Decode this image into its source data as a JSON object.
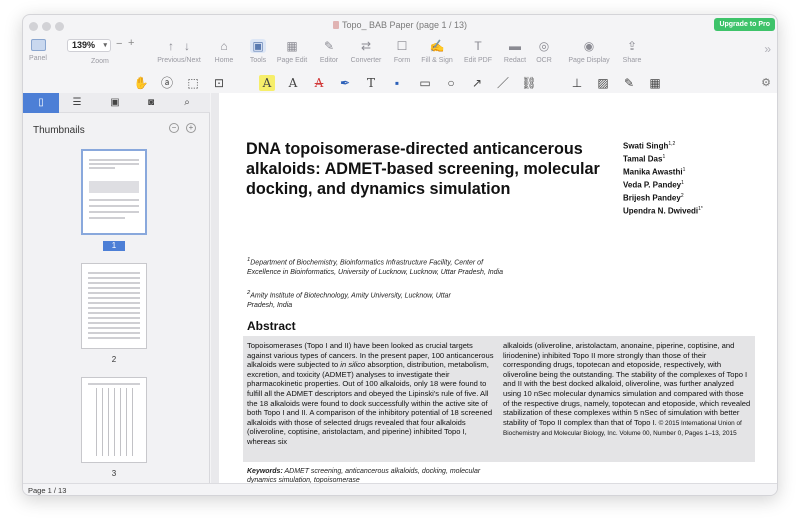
{
  "window": {
    "title": "Topo_ BAB Paper (page 1 / 13)",
    "upgrade_label": "Upgrade to Pro"
  },
  "toolbar": {
    "panel": "Panel",
    "zoom_value": "139%",
    "zoom_label": "Zoom",
    "prev_next": "Previous/Next",
    "home": "Home",
    "tools": "Tools",
    "page_edit": "Page Edit",
    "editor": "Editor",
    "converter": "Converter",
    "form": "Form",
    "fill_sign": "Fill & Sign",
    "edit_pdf": "Edit PDF",
    "redact": "Redact",
    "ocr": "OCR",
    "page_display": "Page Display",
    "share": "Share"
  },
  "sidebar": {
    "thumbnails_title": "Thumbnails",
    "pages": [
      "1",
      "2",
      "3"
    ]
  },
  "document": {
    "title": "DNA topoisomerase-directed anticancerous alkaloids: ADMET-based screening, molecular docking, and dynamics simulation",
    "authors": [
      {
        "name": "Swati Singh",
        "sup": "1,2"
      },
      {
        "name": "Tamal Das",
        "sup": "1"
      },
      {
        "name": "Manika Awasthi",
        "sup": "1"
      },
      {
        "name": "Veda P. Pandey",
        "sup": "1"
      },
      {
        "name": "Brijesh Pandey",
        "sup": "2"
      },
      {
        "name": "Upendra N. Dwivedi",
        "sup": "1*"
      }
    ],
    "affiliation1_sup": "1",
    "affiliation1": "Department of Biochemistry, Bioinformatics Infrastructure Facility, Center of Excellence in Bioinformatics, University of Lucknow, Lucknow, Uttar Pradesh, India",
    "affiliation2_sup": "2",
    "affiliation2": "Amity Institute of Biotechnology, Amity University, Lucknow, Uttar Pradesh, India",
    "abstract_heading": "Abstract",
    "abstract_left_1": "Topoisomerases (Topo I and II) have been looked as crucial targets against various types of cancers. In the present paper, 100 anticancerous alkaloids were subjected to ",
    "abstract_left_italic": "in silico",
    "abstract_left_2": " absorption, distribution, metabolism, excretion, and toxicity (ADMET) analyses to investigate their pharmacokinetic properties. Out of 100 alkaloids, only 18 were found to fulfill all the ADMET descriptors and obeyed the Lipinski's rule of five. All the 18 alkaloids were found to dock successfully within the active site of both Topo I and II. A comparison of the inhibitory potential of 18 screened alkaloids with those of selected drugs revealed that four alkaloids (oliveroline, coptisine, aristolactam, and piperine) inhibited Topo I, whereas six",
    "abstract_right_1": "alkaloids (oliveroline, aristolactam, anonaine, piperine, coptisine, and liriodenine) inhibited Topo II more strongly than those of their corresponding drugs, topotecan and etoposide, respectively, with oliveroline being the outstanding. The stability of the complexes of Topo I and II with the best docked alkaloid, oliveroline, was further analyzed using 10 nSec molecular dynamics simulation and compared with those of the respective drugs, namely, topotecan and etoposide, which revealed stabilization of these complexes within 5 nSec of simulation with better stability of Topo II complex than that of Topo I.",
    "abstract_copyright": " © 2015 International Union of Biochemistry and Molecular Biology, Inc. Volume 00, Number 0, Pages 1–13, 2015",
    "keywords_label": "Keywords:",
    "keywords": " ADMET screening, anticancerous alkaloids, docking, molecular dynamics simulation, topoisomerase"
  },
  "status": {
    "page_indicator": "Page 1 / 13"
  },
  "colors": {
    "accent": "#4d7fd6",
    "upgrade": "#3ec36a",
    "abstract_bg": "#e4e4e6"
  }
}
